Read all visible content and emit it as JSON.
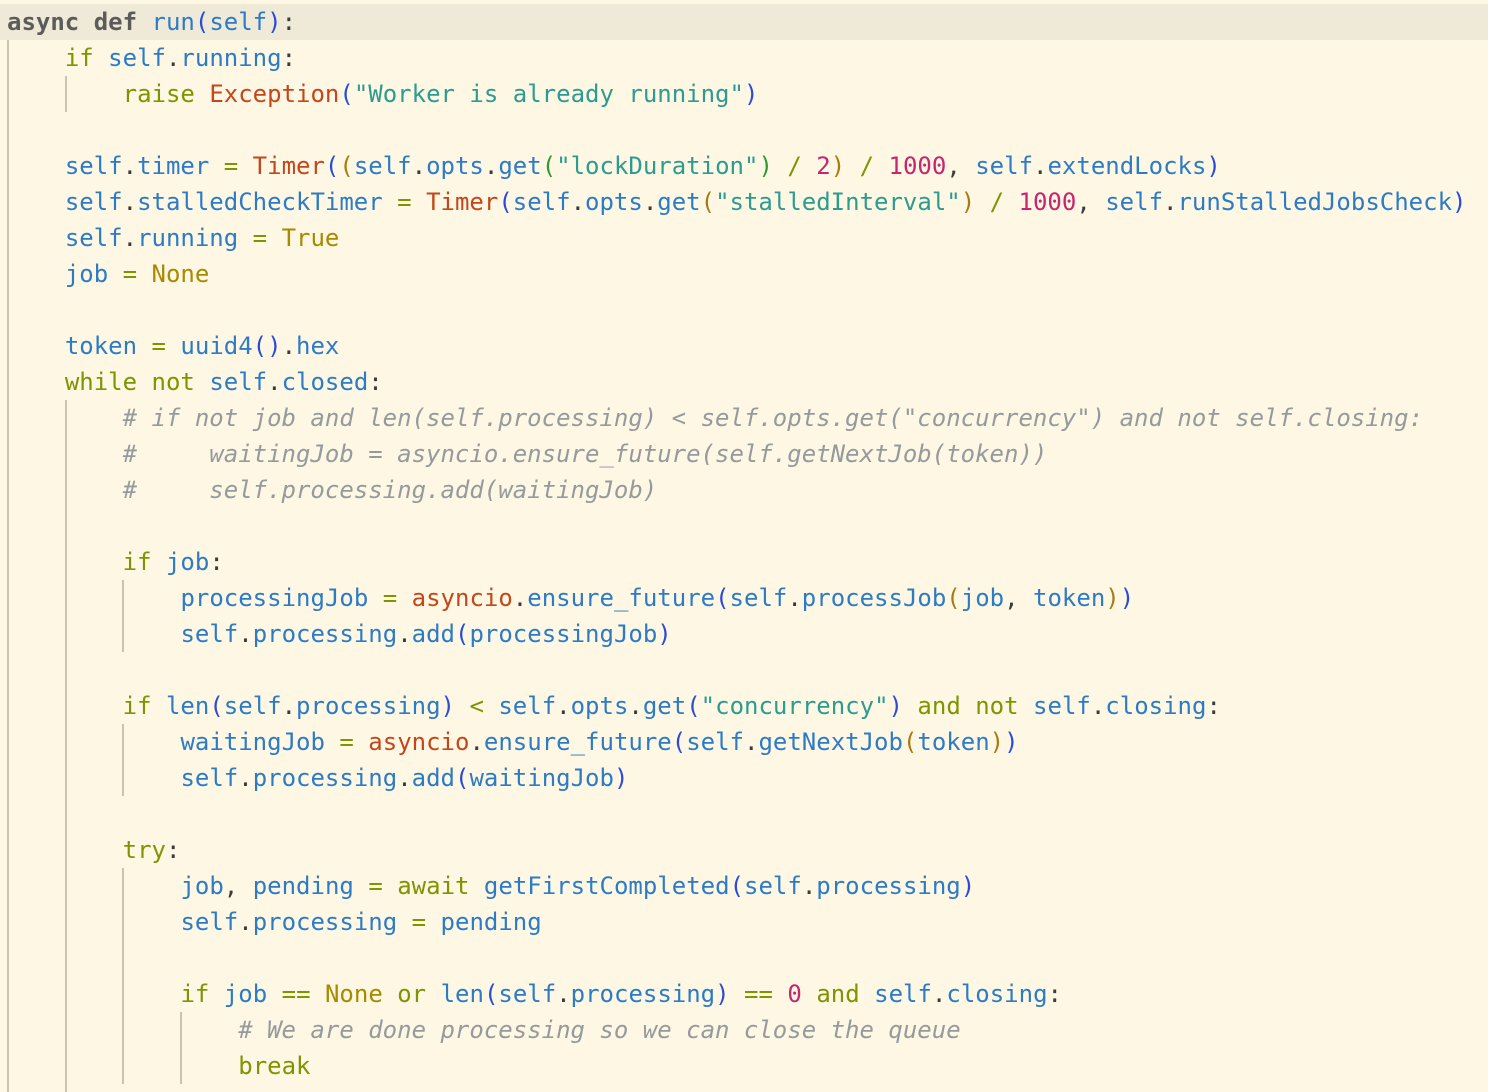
{
  "editor": {
    "language": "python",
    "lines": [
      "async def run(self):",
      "    if self.running:",
      "        raise Exception(\"Worker is already running\")",
      "",
      "    self.timer = Timer((self.opts.get(\"lockDuration\") / 2) / 1000, self.extendLocks)",
      "    self.stalledCheckTimer = Timer(self.opts.get(\"stalledInterval\") / 1000, self.runStalledJobsCheck)",
      "    self.running = True",
      "    job = None",
      "",
      "    token = uuid4().hex",
      "    while not self.closed:",
      "        # if not job and len(self.processing) < self.opts.get(\"concurrency\") and not self.closing:",
      "        #     waitingJob = asyncio.ensure_future(self.getNextJob(token))",
      "        #     self.processing.add(waitingJob)",
      "",
      "        if job:",
      "            processingJob = asyncio.ensure_future(self.processJob(job, token))",
      "            self.processing.add(processingJob)",
      "",
      "        if len(self.processing) < self.opts.get(\"concurrency\") and not self.closing:",
      "            waitingJob = asyncio.ensure_future(self.getNextJob(token))",
      "            self.processing.add(waitingJob)",
      "",
      "        try:",
      "            job, pending = await getFirstCompleted(self.processing)",
      "            self.processing = pending",
      "",
      "            if job == None or len(self.processing) == 0 and self.closing:",
      "                # We are done processing so we can close the queue",
      "                break"
    ]
  },
  "colors": {
    "background": "#fdf7e4",
    "current_line": "#efe9d7",
    "keyword": "#7f9401",
    "identifier": "#2e7bc5",
    "class": "#c3471b",
    "string": "#2d9b8e",
    "number": "#c7256f",
    "constant": "#a78a00",
    "comment": "#959a9c"
  }
}
